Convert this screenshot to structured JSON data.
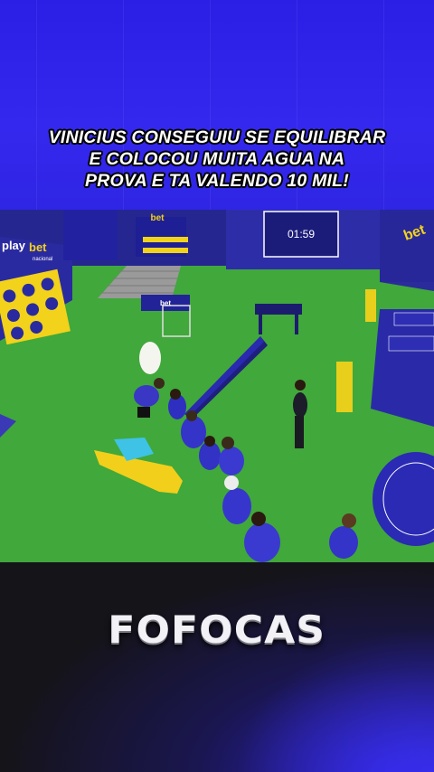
{
  "caption": {
    "line1": "VINICIUS CONSEGUIU SE EQUILIBRAR",
    "line2": "E COLOCOU MUITA AGUA NA",
    "line3": "PROVA E TA VALENDO 10 MIL!"
  },
  "scene": {
    "timer": "01:59",
    "sponsor_playbet": "play",
    "sponsor_playbet_bet": "bet",
    "sponsor_playbet_sub": "nacional",
    "sponsor_bet": "bet",
    "sponsor_bet_sub": "nacional"
  },
  "brand": {
    "name": "FOFOCAS"
  },
  "colors": {
    "top_band": "#3428ee",
    "grass": "#3fa53a",
    "wall": "#2a2a9a",
    "bottom_band": "#151419",
    "caption_text": "#ffffff"
  }
}
